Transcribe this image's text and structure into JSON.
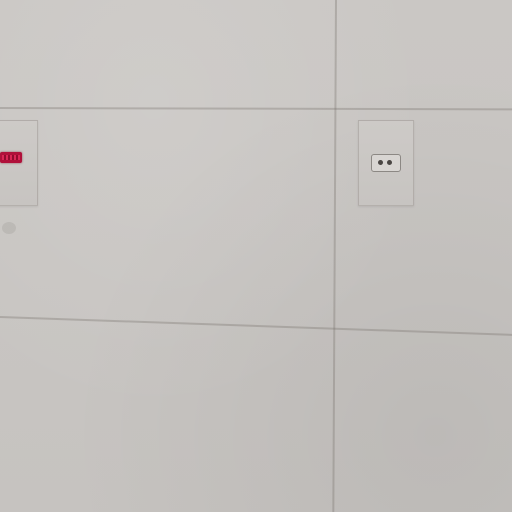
{
  "scene": {
    "background_color": "#c9c6c3",
    "seam_color": "#78736e"
  },
  "left_device": {
    "indicator_color": "#b0103a"
  },
  "right_device": {
    "icon": "power-outlet-icon",
    "faceplate_color": "#d8d5d2"
  }
}
